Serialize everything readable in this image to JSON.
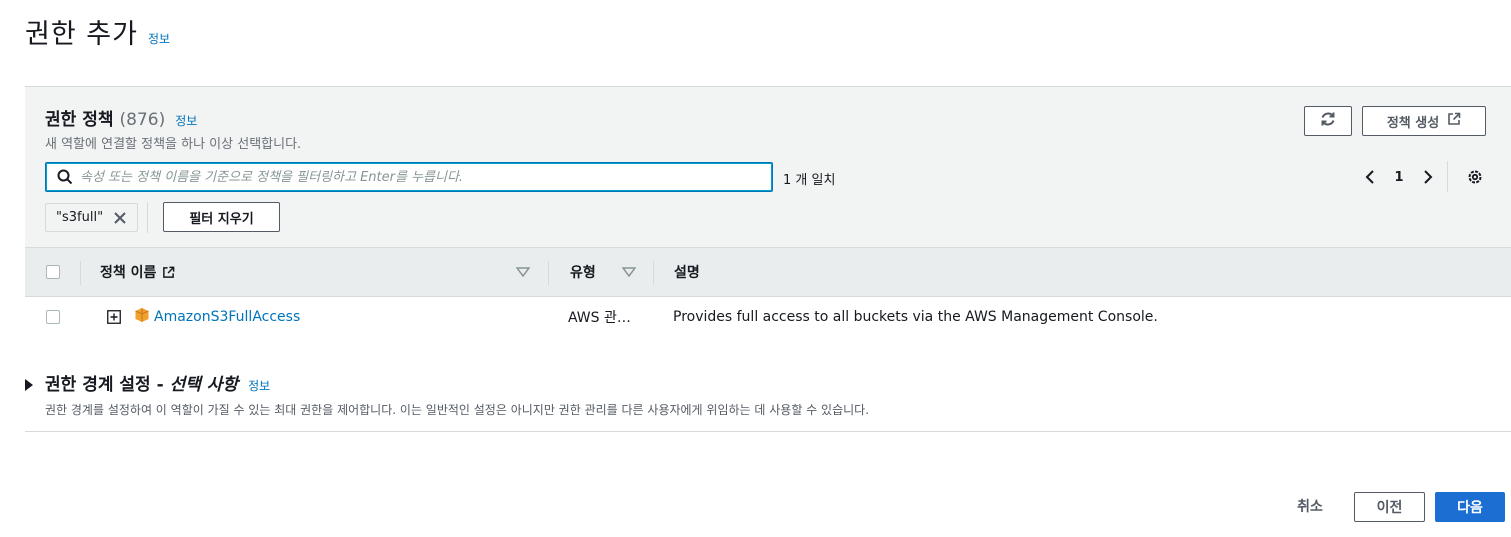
{
  "page": {
    "title": "권한 추가",
    "info_label": "정보"
  },
  "policies_panel": {
    "title": "권한 정책",
    "count": "(876)",
    "info_label": "정보",
    "description": "새 역할에 연결할 정책을 하나 이상 선택합니다.",
    "create_policy_label": "정책 생성"
  },
  "search": {
    "placeholder": "속성 또는 정책 이름을 기준으로 정책을 필터링하고 Enter를 누릅니다.",
    "value": "",
    "match_count": "1 개 일치"
  },
  "pagination": {
    "current_page": "1"
  },
  "filter": {
    "token_label": "\"s3full\"",
    "clear_filters_label": "필터 지우기"
  },
  "table": {
    "columns": {
      "name": "정책 이름",
      "type": "유형",
      "description": "설명"
    },
    "rows": [
      {
        "name": "AmazonS3FullAccess",
        "type": "AWS 관…",
        "description": "Provides full access to all buckets via the AWS Management Console."
      }
    ]
  },
  "permissions_boundary": {
    "title_prefix": "권한 경계 설정 - ",
    "title_optional": "선택 사항",
    "info_label": "정보",
    "description": "권한 경계를 설정하여 이 역할이 가질 수 있는 최대 권한을 제어합니다. 이는 일반적인 설정은 아니지만 권한 관리를 다른 사용자에게 위임하는 데 사용할 수 있습니다."
  },
  "footer": {
    "cancel_label": "취소",
    "previous_label": "이전",
    "next_label": "다음"
  },
  "icons": {
    "search": "search-icon",
    "refresh": "refresh-icon",
    "external_link": "external-link-icon",
    "settings": "gear-icon",
    "policy": "aws-managed-policy-icon"
  },
  "colors": {
    "link": "#0073bb",
    "primary_button": "#1b6fd2",
    "panel_background": "#f2f3f3",
    "policy_icon": "#f0a12c"
  }
}
